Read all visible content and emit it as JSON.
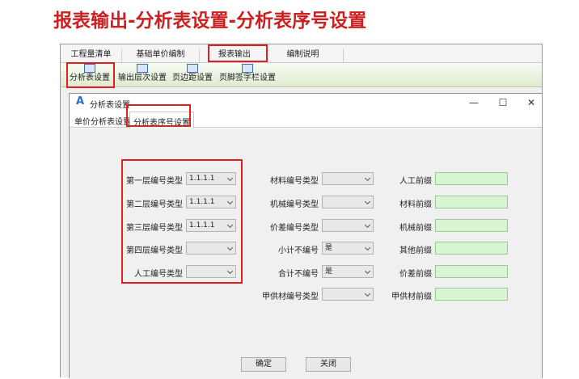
{
  "heading": "报表输出-分析表设置-分析表序号设置",
  "menu": {
    "tabs": [
      "工程量清单",
      "基础单价编制",
      "报表输出",
      "编制说明"
    ]
  },
  "toolbar": {
    "items": [
      "分析表设置",
      "输出层次设置",
      "页边距设置",
      "页脚签字栏设置"
    ]
  },
  "dialog": {
    "title": "分析表设置",
    "tabs": [
      "单价分析表设置",
      "分析表序号设置"
    ],
    "window_controls": {
      "minimize": "—",
      "maximize": "☐",
      "close": "✕"
    },
    "left_fields": [
      {
        "label": "第一层编号类型",
        "value": "1.1.1.1"
      },
      {
        "label": "第二层编号类型",
        "value": "1.1.1.1"
      },
      {
        "label": "第三层编号类型",
        "value": "1.1.1.1"
      },
      {
        "label": "第四层编号类型",
        "value": ""
      },
      {
        "label": "人工编号类型",
        "value": ""
      }
    ],
    "mid_fields": [
      {
        "label": "材料编号类型",
        "value": ""
      },
      {
        "label": "机械编号类型",
        "value": ""
      },
      {
        "label": "价差编号类型",
        "value": ""
      },
      {
        "label": "小计不编号",
        "value": "是"
      },
      {
        "label": "合计不编号",
        "value": "是"
      },
      {
        "label": "甲供材编号类型",
        "value": ""
      }
    ],
    "right_fields": [
      {
        "label": "人工前缀",
        "value": ""
      },
      {
        "label": "材料前缀",
        "value": ""
      },
      {
        "label": "机械前缀",
        "value": ""
      },
      {
        "label": "其他前缀",
        "value": ""
      },
      {
        "label": "价差前缀",
        "value": ""
      },
      {
        "label": "甲供材前缀",
        "value": ""
      }
    ],
    "ok_label": "确定",
    "close_label": "关闭"
  },
  "colors": {
    "highlight": "#e02020",
    "heading": "#cc1f1f",
    "prefix_field": "#d8f5d2"
  }
}
